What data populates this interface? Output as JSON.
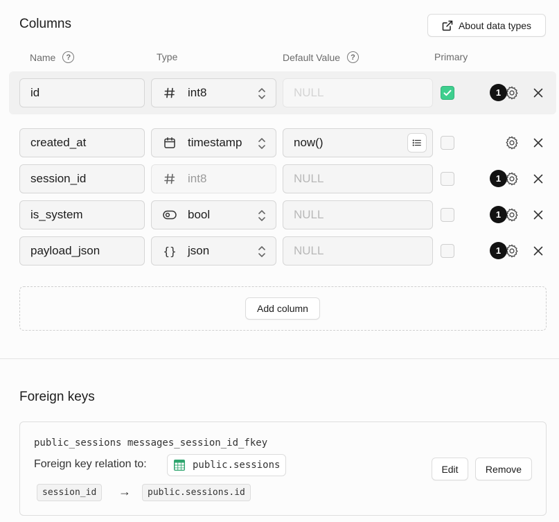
{
  "columns_section": {
    "title": "Columns",
    "about_button_label": "About data types",
    "headers": {
      "name": "Name",
      "type": "Type",
      "default_value": "Default Value",
      "primary": "Primary"
    },
    "help_glyph": "?",
    "rows": [
      {
        "name": "id",
        "type": "int8",
        "type_icon": "hash-icon",
        "type_editable": true,
        "default": "NULL",
        "default_is_placeholder": true,
        "primary": true,
        "badge": "1",
        "highlighted": true
      },
      {
        "name": "created_at",
        "type": "timestamp",
        "type_icon": "calendar-icon",
        "type_editable": true,
        "default": "now()",
        "default_is_placeholder": false,
        "primary": false,
        "badge": "",
        "highlighted": false
      },
      {
        "name": "session_id",
        "type": "int8",
        "type_icon": "hash-icon",
        "type_editable": false,
        "default": "NULL",
        "default_is_placeholder": true,
        "primary": false,
        "badge": "1",
        "highlighted": false
      },
      {
        "name": "is_system",
        "type": "bool",
        "type_icon": "toggle-icon",
        "type_editable": true,
        "default": "NULL",
        "default_is_placeholder": true,
        "primary": false,
        "badge": "1",
        "highlighted": false
      },
      {
        "name": "payload_json",
        "type": "json",
        "type_icon": "braces-icon",
        "type_editable": true,
        "default": "NULL",
        "default_is_placeholder": true,
        "primary": false,
        "badge": "1",
        "highlighted": false
      }
    ],
    "add_column_label": "Add column"
  },
  "foreign_keys_section": {
    "title": "Foreign keys",
    "items": [
      {
        "constraint_name": "public_sessions messages_session_id_fkey",
        "relation_label": "Foreign key relation to:",
        "target_table": "public.sessions",
        "source_column": "session_id",
        "arrow": "→",
        "target_column": "public.sessions.id",
        "edit_label": "Edit",
        "remove_label": "Remove"
      }
    ]
  },
  "colors": {
    "accent_green": "#3ecf8e",
    "badge_bg": "#121212"
  }
}
